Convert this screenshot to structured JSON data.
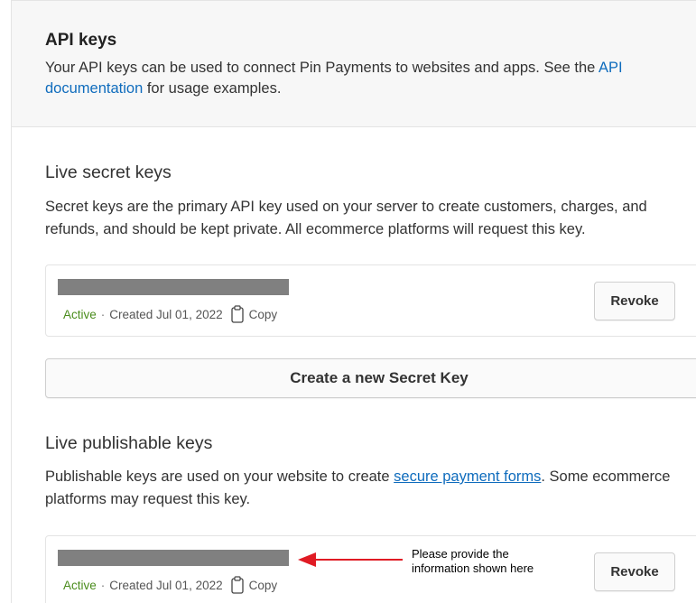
{
  "header": {
    "title": "API keys",
    "desc_before": "Your API keys can be used to connect Pin Payments to websites and apps. See the ",
    "desc_link": "API documentation",
    "desc_after": " for usage examples."
  },
  "secret": {
    "title": "Live secret keys",
    "desc": "Secret keys are the primary API key used on your server to create customers, charges, and refunds, and should be kept private. All ecommerce platforms will request this key.",
    "key": {
      "status": "Active",
      "separator": "·",
      "created": "Created Jul 01, 2022",
      "copy_label": "Copy",
      "revoke_label": "Revoke"
    },
    "create_label": "Create a new Secret Key"
  },
  "publishable": {
    "title": "Live publishable keys",
    "desc_before": "Publishable keys are used on your website to create ",
    "desc_link": "secure payment forms",
    "desc_after": ". Some ecommerce platforms may request this key.",
    "key": {
      "status": "Active",
      "separator": "·",
      "created": "Created Jul 01, 2022",
      "copy_label": "Copy",
      "revoke_label": "Revoke"
    }
  },
  "annotation": {
    "line1": "Please provide the",
    "line2": "information shown here"
  },
  "colors": {
    "link": "#0f6cbd",
    "status_active": "#4a8c1c",
    "masked_key": "#808080",
    "annotation_arrow": "#e01b24"
  },
  "icons": {
    "copy": "clipboard-icon",
    "annotation": "arrow-left-icon"
  }
}
